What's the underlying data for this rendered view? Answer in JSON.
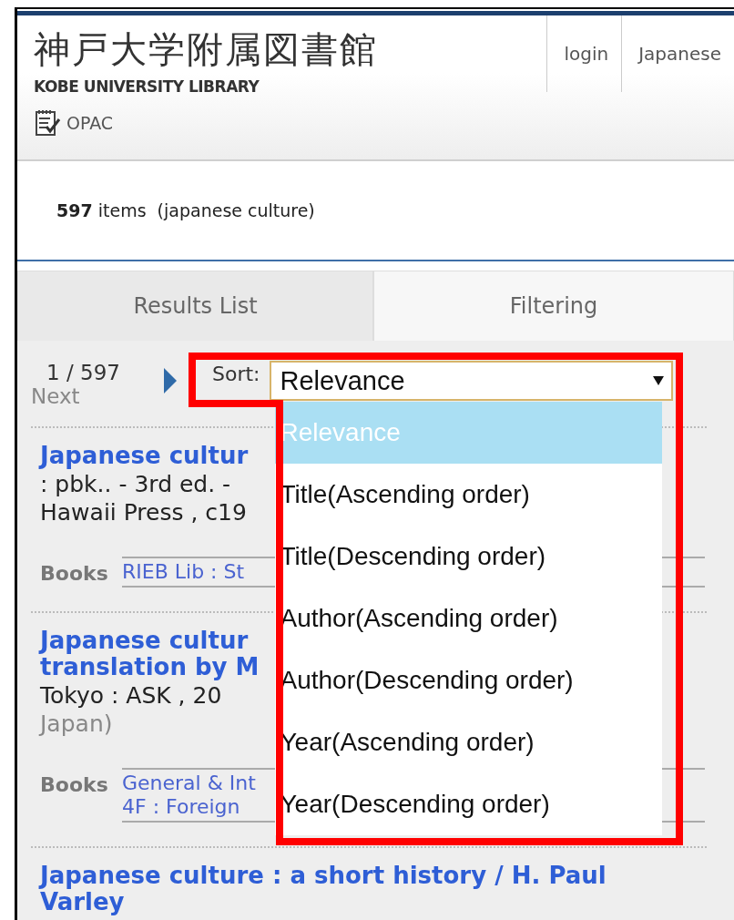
{
  "header": {
    "title_ja": "神戸大学附属図書館",
    "title_en": "KOBE UNIVERSITY LIBRARY",
    "service": "OPAC",
    "nav": [
      {
        "label": "login"
      },
      {
        "label": "Japanese"
      }
    ]
  },
  "summary": {
    "count": "597",
    "text": "items",
    "query": "(japanese culture)"
  },
  "tabs": [
    {
      "label": "Results List",
      "selected": true
    },
    {
      "label": "Filtering",
      "selected": false
    }
  ],
  "pager": {
    "position": "1 / 597",
    "next": "Next"
  },
  "sort": {
    "label": "Sort:",
    "value": "Relevance",
    "options": [
      {
        "label": "Relevance",
        "selected": true
      },
      {
        "label": "Title(Ascending order)",
        "selected": false
      },
      {
        "label": "Title(Descending order)",
        "selected": false
      },
      {
        "label": "Author(Ascending order)",
        "selected": false
      },
      {
        "label": "Author(Descending order)",
        "selected": false
      },
      {
        "label": "Year(Ascending order)",
        "selected": false
      },
      {
        "label": "Year(Descending order)",
        "selected": false
      }
    ]
  },
  "results": [
    {
      "title_lines": [
        "Japanese cultur"
      ],
      "details": [
        {
          "text": ": pbk.. - 3rd ed. -",
          "kind": "text"
        },
        {
          "text": "Hawaii Press , c19",
          "kind": "text"
        }
      ],
      "holdings": {
        "type": "Books",
        "locations": [
          "RIEB Lib : St"
        ]
      }
    },
    {
      "title_lines": [
        "Japanese cultur",
        "translation by M"
      ],
      "details": [
        {
          "text": "Tokyo : ASK , 20",
          "kind": "text"
        },
        {
          "text": "Japan)",
          "kind": "note"
        }
      ],
      "holdings": {
        "type": "Books",
        "locations": [
          "General & Int",
          "4F : Foreign"
        ]
      }
    },
    {
      "title_lines": [
        "Japanese culture : a short history / H. Paul",
        "Varley"
      ]
    }
  ]
}
